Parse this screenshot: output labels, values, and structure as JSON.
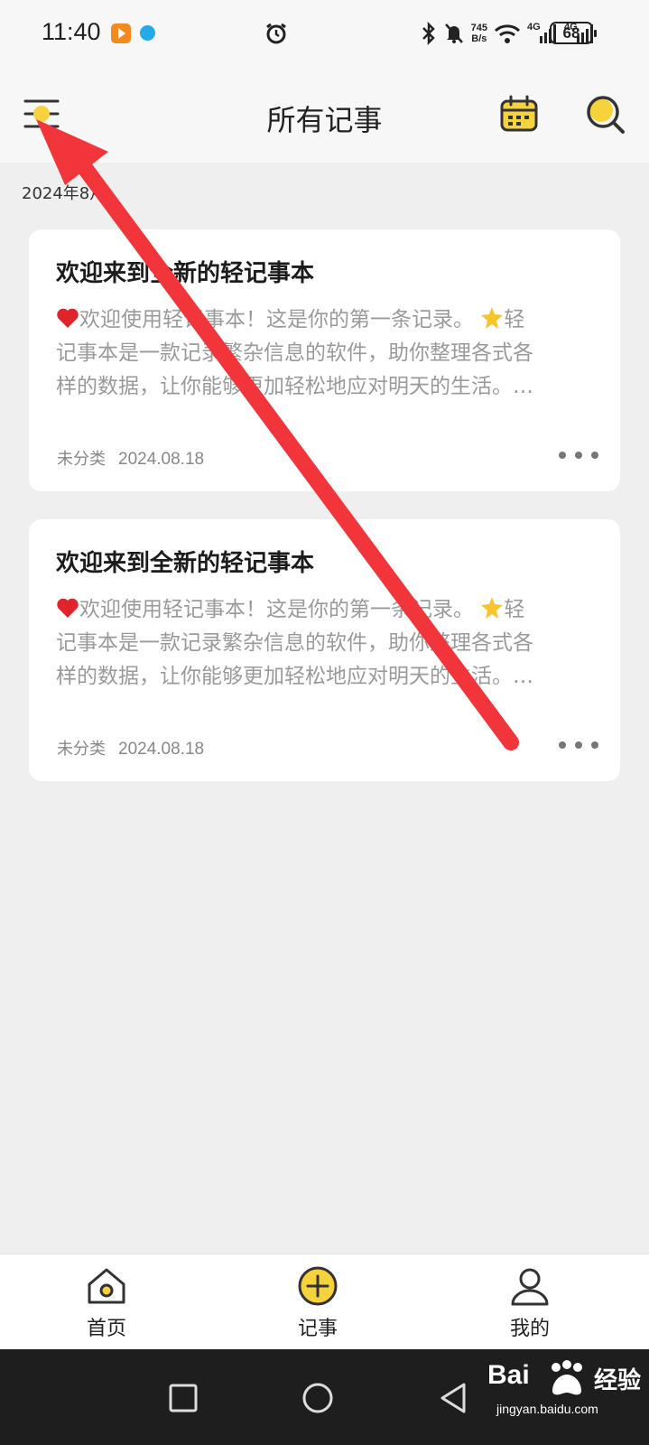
{
  "status_bar": {
    "time": "11:40",
    "net_speed_value": "745",
    "net_speed_unit": "B/s",
    "network_1": "4G",
    "network_2": "4G",
    "battery": "68"
  },
  "app_bar": {
    "title": "所有记事",
    "menu_icon": "menu-icon",
    "calendar_icon": "calendar-icon",
    "search_icon": "search-icon"
  },
  "month_label": "2024年8月",
  "notes": [
    {
      "title": "欢迎来到全新的轻记事本",
      "body_lines": [
        "欢迎使用轻记事本！这是你的第一条记录。",
        "轻",
        "记事本是一款记录繁杂信息的软件，助你整理各式各",
        "样的数据，让你能够更加轻松地应对明天的生活。…"
      ],
      "category": "未分类",
      "date": "2024.08.18"
    },
    {
      "title": "欢迎来到全新的轻记事本",
      "body_lines": [
        "欢迎使用轻记事本！这是你的第一条记录。",
        "轻",
        "记事本是一款记录繁杂信息的软件，助你整理各式各",
        "样的数据，让你能够更加轻松地应对明天的生活。…"
      ],
      "category": "未分类",
      "date": "2024.08.18"
    }
  ],
  "bottom_nav": [
    {
      "label": "首页",
      "icon": "home-icon"
    },
    {
      "label": "记事",
      "icon": "add-note-icon"
    },
    {
      "label": "我的",
      "icon": "profile-icon"
    }
  ],
  "watermark": {
    "brand": "Bai",
    "brand_suffix": "经验",
    "url": "jingyan.baidu.com"
  },
  "colors": {
    "accent_yellow": "#f6d33c",
    "annotation_red": "#f2353a",
    "background": "#efefef",
    "card": "#ffffff"
  }
}
